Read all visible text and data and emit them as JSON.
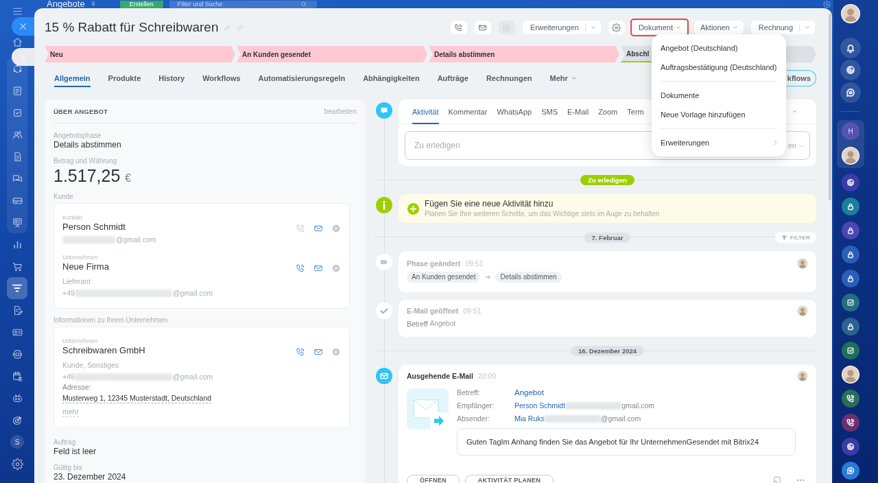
{
  "background_header": {
    "title": "Angebote",
    "create_button": "Erstellen",
    "search": {
      "placeholder": "Filter und Suche"
    }
  },
  "left_sidebar": {
    "sections": [
      {
        "kind": "plain",
        "items": [
          {
            "kind": "menu",
            "selected": false
          },
          {
            "kind": "home",
            "selected": false
          }
        ]
      },
      {
        "kind": "group",
        "items": [
          {
            "kind": "sync",
            "selected": false
          },
          {
            "kind": "feed",
            "selected": false
          },
          {
            "kind": "tasks",
            "selected": false
          },
          {
            "kind": "contacts",
            "selected": false
          },
          {
            "kind": "document",
            "selected": false
          },
          {
            "kind": "chat",
            "selected": false
          },
          {
            "kind": "drive",
            "selected": false
          },
          {
            "kind": "board",
            "selected": false
          }
        ]
      },
      {
        "kind": "plain",
        "items": [
          {
            "kind": "chart",
            "selected": false
          },
          {
            "kind": "cart",
            "selected": false
          },
          {
            "kind": "funnel",
            "selected": true
          },
          {
            "kind": "edit_doc",
            "selected": false
          },
          {
            "kind": "card",
            "selected": false
          },
          {
            "kind": "device",
            "selected": false
          },
          {
            "kind": "calendar",
            "selected": false
          },
          {
            "kind": "robot",
            "selected": false
          },
          {
            "kind": "target",
            "selected": false
          },
          {
            "kind": "avatar",
            "label": "S",
            "selected": false
          },
          {
            "kind": "settings",
            "selected": false
          }
        ]
      }
    ]
  },
  "panel": {
    "title": "15 % Rabatt für Schreibwaren",
    "toolbar": [
      {
        "kind": "phone",
        "disabled": false
      },
      {
        "kind": "mail",
        "disabled": false
      },
      {
        "kind": "chat",
        "disabled": true
      },
      {
        "kind": "split",
        "label": "Erweiterungen"
      },
      {
        "kind": "settings",
        "disabled": false
      },
      {
        "kind": "dropdown",
        "label": "Dokument",
        "highlighted": true
      },
      {
        "kind": "dropdown",
        "label": "Aktionen",
        "highlighted": false
      },
      {
        "kind": "split",
        "label": "Rechnung"
      }
    ],
    "document_menu": {
      "groups": [
        {
          "items": [
            {
              "label": "Angebot (Deutschland)",
              "has_submenu": false
            },
            {
              "label": "Auftragsbestätigung (Deutschland)",
              "has_submenu": false
            }
          ]
        },
        {
          "items": [
            {
              "label": "Dokumente",
              "has_submenu": false
            },
            {
              "label": "Neue Vorlage hinzufügen",
              "has_submenu": false
            }
          ]
        },
        {
          "items": [
            {
              "label": "Erweiterungen",
              "has_submenu": true
            }
          ]
        }
      ]
    },
    "stages": [
      {
        "label": "Neu",
        "kind": "step",
        "reached": true
      },
      {
        "label": "An Kunden gesendet",
        "kind": "step",
        "reached": true
      },
      {
        "label": "Details abstimmen",
        "kind": "step",
        "reached": true
      },
      {
        "label": "Abschl",
        "kind": "final",
        "reached": false
      }
    ],
    "tabs": [
      {
        "label": "Allgemein",
        "kind": "tab",
        "selected": true
      },
      {
        "label": "Produkte",
        "kind": "tab",
        "selected": false
      },
      {
        "label": "History",
        "kind": "tab",
        "selected": false
      },
      {
        "label": "Workflows",
        "kind": "tab",
        "selected": false
      },
      {
        "label": "Automatisierungsregeln",
        "kind": "tab",
        "selected": false
      },
      {
        "label": "Abhängigkeiten",
        "kind": "tab",
        "selected": false
      },
      {
        "label": "Aufträge",
        "kind": "tab",
        "selected": false
      },
      {
        "label": "Rechnungen",
        "kind": "tab",
        "selected": false
      },
      {
        "label": "Mehr",
        "kind": "more",
        "selected": false
      }
    ],
    "workflows_button": "kflows",
    "about": {
      "heading": "ÜBER ANGEBOT",
      "edit_link": "bearbeiten",
      "blocks": [
        {
          "kind": "field",
          "label": "Angebotsphase",
          "value": "Details abstimmen"
        },
        {
          "kind": "amount",
          "label": "Betrag und Währung",
          "value": "1.517,25",
          "currency": "€"
        },
        {
          "kind": "client",
          "label": "Kunde",
          "entries": [
            {
              "type_label": "Kontakt",
              "name": "Person Schmidt",
              "phone_available": false,
              "lines": [
                {
                  "kind": "redacted",
                  "after": "@gmail.com"
                }
              ]
            },
            {
              "type_label": "Unternehmen",
              "name": "Neue Firma",
              "phone_available": true,
              "lines": [
                {
                  "kind": "text",
                  "text": "Lieferant"
                },
                {
                  "kind": "redacted",
                  "before": "+49",
                  "after": "@gmail.com"
                }
              ]
            }
          ]
        },
        {
          "kind": "client",
          "label": "Informationen zu Ihrem Unternehmen",
          "entries": [
            {
              "type_label": "Unternehmen",
              "name": "Schreibwaren GmbH",
              "phone_available": true,
              "lines": [
                {
                  "kind": "text",
                  "text": "Kunde, Sonstiges"
                },
                {
                  "kind": "redacted",
                  "before": "+49",
                  "after": "@gmail.com"
                },
                {
                  "kind": "label",
                  "text": "Adresse:"
                },
                {
                  "kind": "address",
                  "text": "Musterweg 1, 12345 Musterstadt, Deutschland"
                },
                {
                  "kind": "link",
                  "text": "mehr"
                }
              ]
            }
          ]
        },
        {
          "kind": "field",
          "label": "Auftrag",
          "value": "Feld ist leer"
        },
        {
          "kind": "field",
          "label": "Gültig bis",
          "value": "23. Dezember 2024"
        }
      ]
    },
    "timeline": {
      "composer": {
        "tabs": [
          {
            "label": "Aktivität",
            "selected": true
          },
          {
            "label": "Kommentar",
            "selected": false
          },
          {
            "label": "WhatsApp",
            "selected": false
          },
          {
            "label": "SMS",
            "selected": false
          },
          {
            "label": "E-Mail",
            "selected": false
          },
          {
            "label": "Zoom",
            "selected": false
          },
          {
            "label": "Term",
            "selected": false
          }
        ],
        "placeholder": "Zu erledigen",
        "deadline_label": "en"
      },
      "todo_badge": "Zu erledigen",
      "add_activity": {
        "title": "Fügen Sie eine neue Aktivität hinzu",
        "hint": "Planen Sie Ihre weiteren Schritte, um das Wichtige stets im Auge zu behalten"
      },
      "filter_button": "FILTER",
      "days": [
        {
          "date": "7. Februar",
          "entries": [
            {
              "kind": "stage_change",
              "title": "Phase geändert",
              "time": "09:51",
              "from": "An Kunden gesendet",
              "to": "Details abstimmen"
            },
            {
              "kind": "email_opened",
              "title": "E-Mail geöffnet",
              "time": "09:51",
              "subject_label": "Betreff",
              "subject": "Angebot"
            }
          ]
        },
        {
          "date": "16. Dezember 2024",
          "entries": [
            {
              "kind": "email",
              "title": "Ausgehende E-Mail",
              "time": "20:09",
              "fields": [
                {
                  "label": "Betreff:",
                  "value": "Angebot",
                  "redacted": false
                },
                {
                  "label": "Empfänger:",
                  "value": "Person Schmidt",
                  "redacted": true,
                  "after": "gmail.com"
                },
                {
                  "label": "Absender:",
                  "value": "Mia Ruks",
                  "redacted": true,
                  "after": "@gmail.com"
                }
              ],
              "message": "Guten TagIm Anhang finden Sie das Angebot für Ihr UnternehmenGesendet mit Bitrix24",
              "buttons": [
                "ÖFFNEN",
                "AKTIVITÄT PLANEN"
              ]
            }
          ]
        }
      ]
    }
  },
  "right_sidebar": {
    "sections": [
      {
        "kind": "plain",
        "items": [
          {
            "kind": "avatar"
          },
          {
            "kind": "bell"
          },
          {
            "kind": "rings"
          },
          {
            "kind": "chat"
          }
        ]
      },
      {
        "kind": "group",
        "items": [
          {
            "kind": "letter",
            "label": "H",
            "color": "#5552b4"
          },
          {
            "kind": "avatar"
          }
        ]
      },
      {
        "kind": "plain",
        "items": [
          {
            "kind": "rings",
            "color": "#3c3ca6"
          },
          {
            "kind": "lock",
            "color": "#1a7f99"
          },
          {
            "kind": "lock",
            "color": "#4a47b0"
          },
          {
            "kind": "lock",
            "color": "#2a5fb8"
          },
          {
            "kind": "lock",
            "color": "#2a5fb8"
          },
          {
            "kind": "check",
            "color": "#256e7e"
          },
          {
            "kind": "lock",
            "color": "#2a6390"
          },
          {
            "kind": "check",
            "color": "#1f6f5a"
          },
          {
            "kind": "avatar"
          },
          {
            "kind": "phone",
            "color": "#2a6e5a"
          },
          {
            "kind": "phone",
            "color": "#6a3070"
          },
          {
            "kind": "rings",
            "color": "#3c3ca6"
          },
          {
            "kind": "chat",
            "color": "#2a7ad8"
          }
        ]
      }
    ]
  }
}
